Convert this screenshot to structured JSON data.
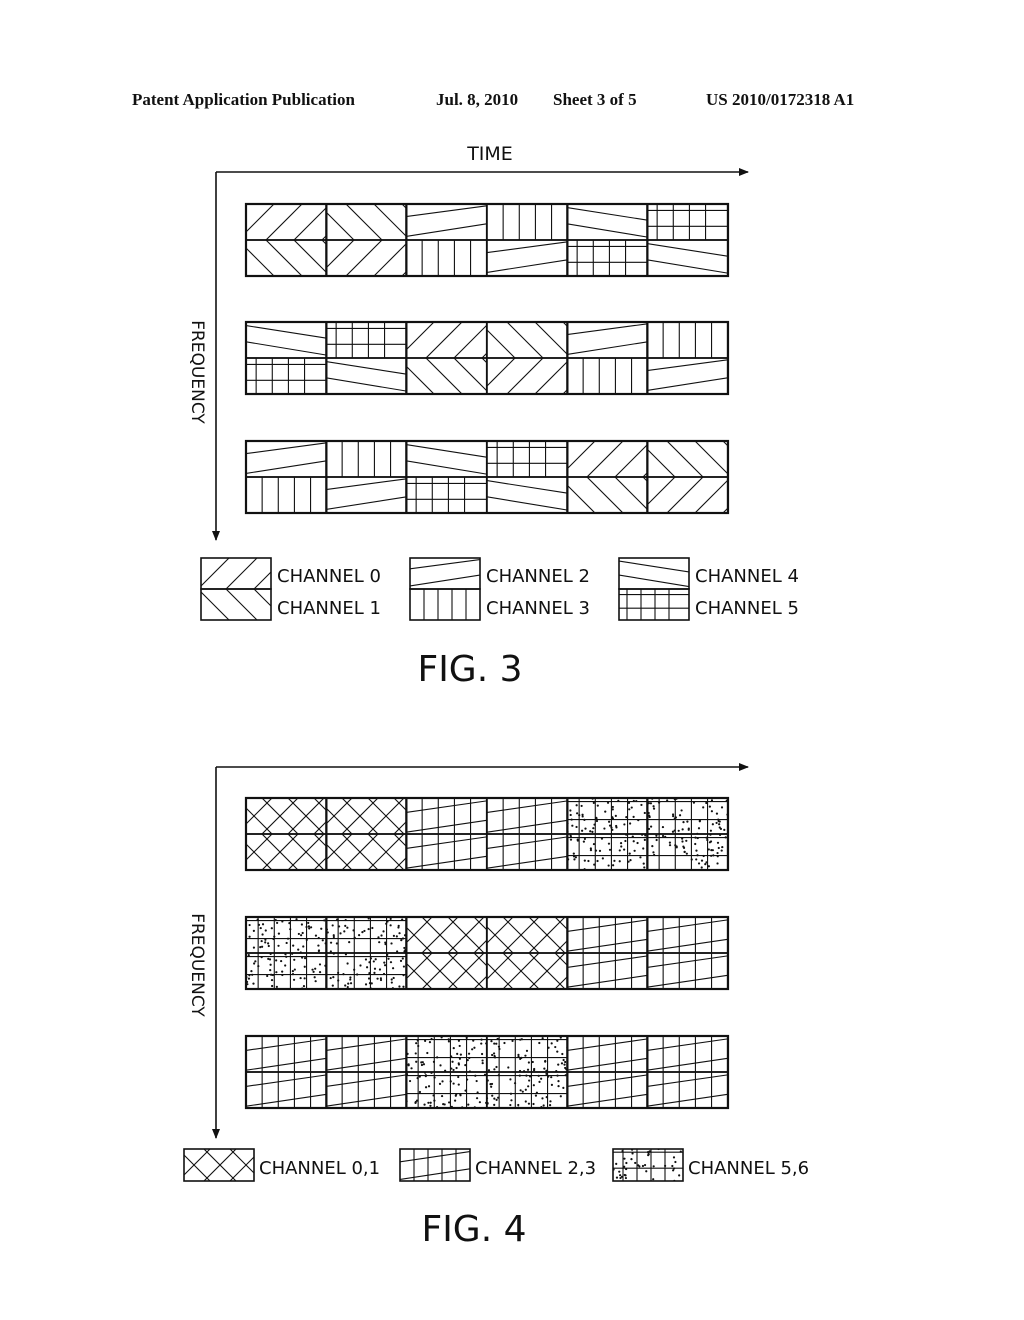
{
  "header": {
    "publication": "Patent Application Publication",
    "date": "Jul. 8, 2010",
    "sheet": "Sheet 3 of 5",
    "number": "US 2010/0172318 A1"
  },
  "fig3": {
    "caption": "FIG. 3",
    "x_axis_label": "TIME",
    "y_axis_label": "FREQUENCY",
    "blocks": [
      {
        "cells": [
          [
            "ch0",
            "ch1"
          ],
          [
            "ch1",
            "ch0"
          ],
          [
            "ch2",
            "ch3"
          ],
          [
            "ch3",
            "ch2"
          ],
          [
            "ch4",
            "ch5"
          ],
          [
            "ch5",
            "ch4"
          ]
        ]
      },
      {
        "cells": [
          [
            "ch4",
            "ch5"
          ],
          [
            "ch5",
            "ch4"
          ],
          [
            "ch0",
            "ch1"
          ],
          [
            "ch1",
            "ch0"
          ],
          [
            "ch2",
            "ch3"
          ],
          [
            "ch3",
            "ch2"
          ]
        ]
      },
      {
        "cells": [
          [
            "ch2",
            "ch3"
          ],
          [
            "ch3",
            "ch2"
          ],
          [
            "ch4",
            "ch5"
          ],
          [
            "ch5",
            "ch4"
          ],
          [
            "ch0",
            "ch1"
          ],
          [
            "ch1",
            "ch0"
          ]
        ]
      }
    ],
    "legend": [
      {
        "top": "ch0",
        "bottom": "ch1",
        "top_label": "CHANNEL 0",
        "bottom_label": "CHANNEL 1"
      },
      {
        "top": "ch2",
        "bottom": "ch3",
        "top_label": "CHANNEL 2",
        "bottom_label": "CHANNEL 3"
      },
      {
        "top": "ch4",
        "bottom": "ch5",
        "top_label": "CHANNEL 4",
        "bottom_label": "CHANNEL 5"
      }
    ]
  },
  "fig4": {
    "caption": "FIG. 4",
    "y_axis_label": "FREQUENCY",
    "blocks": [
      {
        "pairs": [
          "c01",
          "c23",
          "c56"
        ]
      },
      {
        "pairs": [
          "c56",
          "c01",
          "c23"
        ]
      },
      {
        "pairs": [
          "c23",
          "c56",
          "c23"
        ]
      }
    ],
    "legend": [
      {
        "pattern": "c01",
        "label": "CHANNEL 0,1"
      },
      {
        "pattern": "c23",
        "label": "CHANNEL 2,3"
      },
      {
        "pattern": "c56",
        "label": "CHANNEL 5,6"
      }
    ]
  }
}
